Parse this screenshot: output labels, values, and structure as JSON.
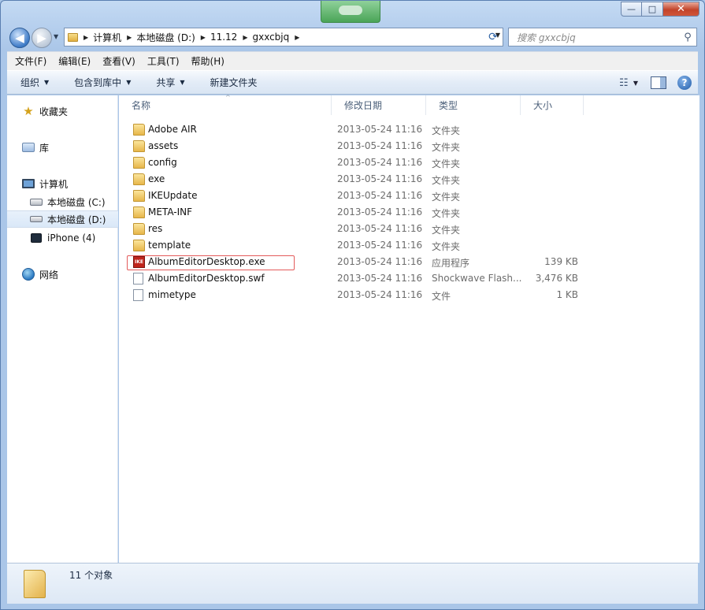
{
  "window": {
    "caption_min": "—",
    "caption_max": "□",
    "caption_close": "✕"
  },
  "toolbar_nav": {
    "back_glyph": "◀",
    "forward_glyph": "▶",
    "dropdown_glyph": "▼"
  },
  "address": {
    "sep_glyph": "▶",
    "crumbs": [
      "计算机",
      "本地磁盘 (D:)",
      "11.12",
      "gxxcbjq"
    ],
    "drop_glyph": "▼",
    "refresh_glyph": "⟳"
  },
  "search": {
    "placeholder": "搜索 gxxcbjq",
    "icon_glyph": "⚲"
  },
  "menubar": {
    "items": [
      "文件(F)",
      "编辑(E)",
      "查看(V)",
      "工具(T)",
      "帮助(H)"
    ]
  },
  "cmdbar": {
    "organize": "组织",
    "include_in_library": "包含到库中",
    "share": "共享",
    "new_folder": "新建文件夹",
    "arrow_glyph": "▼",
    "view_glyph": "☷",
    "help_glyph": "?"
  },
  "navpane": {
    "favorites": "收藏夹",
    "libraries": "库",
    "computer": "计算机",
    "drive_c": "本地磁盘 (C:)",
    "drive_d": "本地磁盘 (D:)",
    "iphone": "iPhone (4)",
    "network": "网络",
    "star_glyph": "★"
  },
  "filelist": {
    "columns": {
      "name": "名称",
      "date": "修改日期",
      "type": "类型",
      "size": "大小"
    },
    "sort_glyph": "^",
    "rows": [
      {
        "name": "Adobe AIR",
        "date": "2013-05-24 11:16",
        "type": "文件夹",
        "size": "",
        "icon": "folder-icon"
      },
      {
        "name": "assets",
        "date": "2013-05-24 11:16",
        "type": "文件夹",
        "size": "",
        "icon": "folder-icon"
      },
      {
        "name": "config",
        "date": "2013-05-24 11:16",
        "type": "文件夹",
        "size": "",
        "icon": "folder-icon"
      },
      {
        "name": "exe",
        "date": "2013-05-24 11:16",
        "type": "文件夹",
        "size": "",
        "icon": "folder-icon"
      },
      {
        "name": "IKEUpdate",
        "date": "2013-05-24 11:16",
        "type": "文件夹",
        "size": "",
        "icon": "folder-icon"
      },
      {
        "name": "META-INF",
        "date": "2013-05-24 11:16",
        "type": "文件夹",
        "size": "",
        "icon": "folder-icon"
      },
      {
        "name": "res",
        "date": "2013-05-24 11:16",
        "type": "文件夹",
        "size": "",
        "icon": "folder-icon"
      },
      {
        "name": "template",
        "date": "2013-05-24 11:16",
        "type": "文件夹",
        "size": "",
        "icon": "folder-icon"
      },
      {
        "name": "AlbumEditorDesktop.exe",
        "date": "2013-05-24 11:16",
        "type": "应用程序",
        "size": "139 KB",
        "icon": "exe-icon"
      },
      {
        "name": "AlbumEditorDesktop.swf",
        "date": "2013-05-24 11:16",
        "type": "Shockwave Flash...",
        "size": "3,476 KB",
        "icon": "document-icon"
      },
      {
        "name": "mimetype",
        "date": "2013-05-24 11:16",
        "type": "文件",
        "size": "1 KB",
        "icon": "document-icon"
      }
    ]
  },
  "status": {
    "text": "11 个对象"
  },
  "colors": {
    "highlight_border": "#e35b5b",
    "window_frame": "#aac6e8",
    "close_button": "#c2442b"
  }
}
